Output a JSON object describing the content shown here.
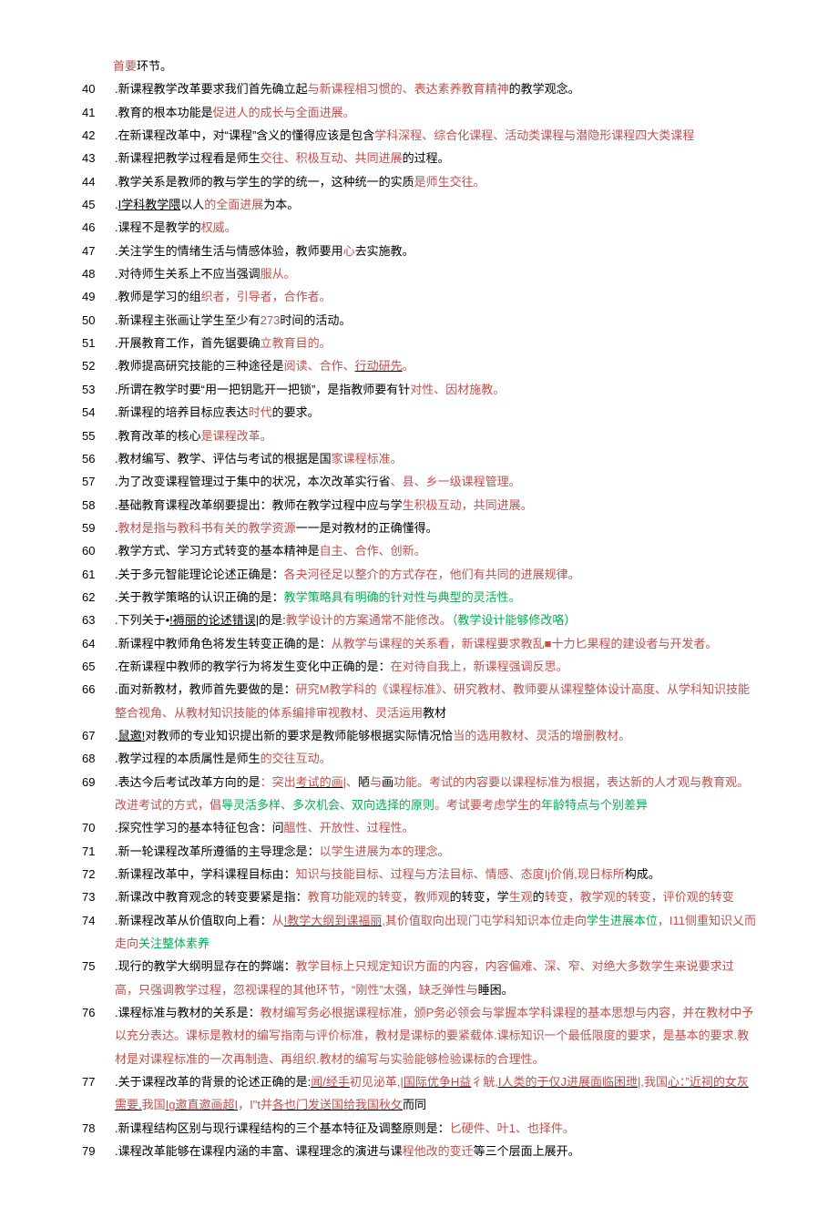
{
  "pre_line": [
    {
      "t": "首要",
      "c": "r"
    },
    {
      "t": "环节。",
      "c": ""
    }
  ],
  "items": [
    {
      "n": "40",
      "segs": [
        {
          "t": ".新课程教学改革要求我们首先确立起",
          "c": ""
        },
        {
          "t": "与新课程相习惯的、表达素养教育精神",
          "c": "r"
        },
        {
          "t": "的教学观念。",
          "c": ""
        }
      ]
    },
    {
      "n": "41",
      "segs": [
        {
          "t": ".教育的根本功能是",
          "c": ""
        },
        {
          "t": "促进人的成长与全面进展。",
          "c": "r"
        }
      ]
    },
    {
      "n": "42",
      "segs": [
        {
          "t": ".在新课程改革中，对“课程”含义的懂得应该是包含",
          "c": ""
        },
        {
          "t": "学科深程、综合化课程、活动类课程与潜隐形课程四大类课程",
          "c": "r"
        }
      ]
    },
    {
      "n": "43",
      "segs": [
        {
          "t": ".新课程把教学过程看是师生",
          "c": ""
        },
        {
          "t": "交往、积极互动、共同进展",
          "c": "r"
        },
        {
          "t": "的过程。",
          "c": ""
        }
      ]
    },
    {
      "n": "44",
      "segs": [
        {
          "t": ".教学关系是教师的教与学生的学的统一，这种统一的实质",
          "c": ""
        },
        {
          "t": "是师生交往。",
          "c": "r"
        }
      ]
    },
    {
      "n": "45",
      "segs": [
        {
          "t": ".",
          "c": ""
        },
        {
          "t": "I学科教学隈",
          "c": "",
          "u": 1
        },
        {
          "t": "以人",
          "c": ""
        },
        {
          "t": "的全面进展",
          "c": "r"
        },
        {
          "t": "为本。",
          "c": ""
        }
      ]
    },
    {
      "n": "46",
      "segs": [
        {
          "t": ".课程不是教学的",
          "c": ""
        },
        {
          "t": "权威。",
          "c": "r"
        }
      ]
    },
    {
      "n": "47",
      "segs": [
        {
          "t": ".关注学生的情绪生活与情感体验，教师要用",
          "c": ""
        },
        {
          "t": "心",
          "c": "r"
        },
        {
          "t": "去实施教。",
          "c": ""
        }
      ]
    },
    {
      "n": "48",
      "segs": [
        {
          "t": ".对待师生关系上不应当强调",
          "c": ""
        },
        {
          "t": "服从。",
          "c": "r"
        }
      ]
    },
    {
      "n": "49",
      "segs": [
        {
          "t": ".教师是学习的组",
          "c": ""
        },
        {
          "t": "织者，引导者，合作者。",
          "c": "r"
        }
      ]
    },
    {
      "n": "50",
      "segs": [
        {
          "t": ".新课程主张画让学生至少有",
          "c": ""
        },
        {
          "t": "273",
          "c": "r"
        },
        {
          "t": "时间的活动。",
          "c": ""
        }
      ]
    },
    {
      "n": "51",
      "segs": [
        {
          "t": ".开展教育工作，首先锯要确",
          "c": ""
        },
        {
          "t": "立教育目的。",
          "c": "r"
        }
      ]
    },
    {
      "n": "52",
      "segs": [
        {
          "t": ".教师提高研究技能的三种途径是",
          "c": ""
        },
        {
          "t": "阅读、合作、",
          "c": "r"
        },
        {
          "t": "行动研先",
          "c": "r",
          "u": 1
        },
        {
          "t": "。",
          "c": "r"
        }
      ]
    },
    {
      "n": "53",
      "segs": [
        {
          "t": ".所谓在教学时要“用一把钥匙开一把锁”，是指教师要有针",
          "c": ""
        },
        {
          "t": "对性、因材施教。",
          "c": "r"
        }
      ]
    },
    {
      "n": "54",
      "segs": [
        {
          "t": ".新课程的培养目标应表达",
          "c": ""
        },
        {
          "t": "时代",
          "c": "r"
        },
        {
          "t": "的要求。",
          "c": ""
        }
      ]
    },
    {
      "n": "55",
      "segs": [
        {
          "t": ".教育改革的核心",
          "c": ""
        },
        {
          "t": "是课程改革。",
          "c": "r"
        }
      ]
    },
    {
      "n": "56",
      "segs": [
        {
          "t": ".教材编写、教学、评估与考试的根据是国",
          "c": ""
        },
        {
          "t": "家课程标准。",
          "c": "r"
        }
      ]
    },
    {
      "n": "57",
      "segs": [
        {
          "t": ".为了改变课程管理过于集中的状况，本次改革实行省",
          "c": ""
        },
        {
          "t": "、县、乡一级课程管理。",
          "c": "r"
        }
      ]
    },
    {
      "n": "58",
      "segs": [
        {
          "t": ".基础教育课程改革纲要提出：教师在教学过程中应与学",
          "c": ""
        },
        {
          "t": "生积极互动，共同进展。",
          "c": "r"
        }
      ]
    },
    {
      "n": "59",
      "segs": [
        {
          "t": ".",
          "c": ""
        },
        {
          "t": "教材是指与教科书有关的教学资源",
          "c": "r"
        },
        {
          "t": "一一是对教材的正确懂得。",
          "c": ""
        }
      ]
    },
    {
      "n": "60",
      "segs": [
        {
          "t": ".教学方式、学习方式转变的基本精神是",
          "c": ""
        },
        {
          "t": "自主、合作、创新。",
          "c": "r"
        }
      ]
    },
    {
      "n": "61",
      "segs": [
        {
          "t": ".关于多元智能理论论述正确是：",
          "c": ""
        },
        {
          "t": "各夬河径足以整介的方式存在，他们有共同的进展规律。",
          "c": "r"
        }
      ]
    },
    {
      "n": "62",
      "segs": [
        {
          "t": ".关于教学策略的认识正确的是：",
          "c": ""
        },
        {
          "t": "教学策略具有明确的针对性与典型的灵活性。",
          "c": "g"
        }
      ]
    },
    {
      "n": "63",
      "segs": [
        {
          "t": ".下列关于•",
          "c": ""
        },
        {
          "t": "!褥丽的论述错误|",
          "c": "",
          "u": 1
        },
        {
          "t": "的是:",
          "c": ""
        },
        {
          "t": "教学设计的方案通常不能修改。",
          "c": "r"
        },
        {
          "t": "（教学设计能够修改咯）",
          "c": "g"
        }
      ]
    },
    {
      "n": "64",
      "segs": [
        {
          "t": ".新课程中教师角色将发生转变正确的是：",
          "c": ""
        },
        {
          "t": "从教学与课程的关系看，新课程要求教乱■十力匕果程的建设者与开发者。",
          "c": "r"
        }
      ]
    },
    {
      "n": "65",
      "segs": [
        {
          "t": ".在新课程中教师的教学行为将发生变化中正确的是：",
          "c": ""
        },
        {
          "t": "在对待自我上，新课程强调反思。",
          "c": "r"
        }
      ]
    },
    {
      "n": "66",
      "segs": [
        {
          "t": ".面对新教材，教师首先要做的是：",
          "c": ""
        },
        {
          "t": "研究M教学科的《课程标准》、研究教材、教师要从课程整体设计高度、从学科知识技能整合视角、从教材知识技能的体系编排审视教材、灵活运用",
          "c": "r"
        },
        {
          "t": "教材",
          "c": ""
        }
      ]
    },
    {
      "n": "67",
      "segs": [
        {
          "t": ".",
          "c": ""
        },
        {
          "t": "鼠邀!",
          "c": "",
          "u": 1
        },
        {
          "t": "对教师的专业知识提出新的要求是教师能够根据实际情况恰",
          "c": ""
        },
        {
          "t": "当的选用教材、灵活的增删教材。",
          "c": "r"
        }
      ]
    },
    {
      "n": "68",
      "segs": [
        {
          "t": ".教学过程的本质属性是师生",
          "c": ""
        },
        {
          "t": "的交往互动。",
          "c": "r"
        }
      ]
    },
    {
      "n": "69",
      "segs": [
        {
          "t": ".表达今后考试改革方向的是",
          "c": ""
        },
        {
          "t": "：突出",
          "c": "r"
        },
        {
          "t": "考试的画|",
          "c": "r",
          "u": 1
        },
        {
          "t": "、",
          "c": "r"
        },
        {
          "t": "陋",
          "c": ""
        },
        {
          "t": "与",
          "c": "r"
        },
        {
          "t": "画",
          "c": ""
        },
        {
          "t": "功能。考试的内容要以课程标准为根据，表达新的人才观与教育观",
          "c": "r"
        },
        {
          "t": "。改进考试的方式，倡",
          "c": "r"
        },
        {
          "t": "导灵活多样、多次机会、双向选择的原则",
          "c": "g"
        },
        {
          "t": "。考试要考虑学生的",
          "c": "r"
        },
        {
          "t": "年龄特点与个别差异",
          "c": "g"
        }
      ]
    },
    {
      "n": "70",
      "segs": [
        {
          "t": ".探究性学习的基本特征包含：问",
          "c": ""
        },
        {
          "t": "醞性、开放性、过程性。",
          "c": "r"
        }
      ]
    },
    {
      "n": "71",
      "segs": [
        {
          "t": ".新一轮课程改革所遵循的主导理念是：",
          "c": ""
        },
        {
          "t": "以学生进展为本的理念。",
          "c": "r"
        }
      ]
    },
    {
      "n": "72",
      "segs": [
        {
          "t": ".新课程改革中，学科课程目标由：",
          "c": ""
        },
        {
          "t": "知识与技能目标、过程与方法目标、情感、态度Ij价俏,现日标所",
          "c": "r"
        },
        {
          "t": "构成。",
          "c": ""
        }
      ]
    },
    {
      "n": "73",
      "segs": [
        {
          "t": ".新课改中教育观念的转变要紧是指：",
          "c": ""
        },
        {
          "t": "教育功能观的转变，教师观",
          "c": "r"
        },
        {
          "t": "的转变，学",
          "c": ""
        },
        {
          "t": "生观",
          "c": "r"
        },
        {
          "t": "的",
          "c": ""
        },
        {
          "t": "转变，教学观的转变，评价观的转变",
          "c": "r"
        }
      ]
    },
    {
      "n": "74",
      "segs": [
        {
          "t": ".新课程改革从价值取向上看：",
          "c": ""
        },
        {
          "t": "从",
          "c": "r"
        },
        {
          "t": "!教学大纲到课褔丽,",
          "c": "r",
          "u": 1
        },
        {
          "t": "其价值取向出现门屯学科知识本位走向",
          "c": "r"
        },
        {
          "t": "学生进展本位",
          "c": "g"
        },
        {
          "t": "，I11侧重知识乂而走向",
          "c": "r"
        },
        {
          "t": "关注整体素养",
          "c": "g"
        }
      ]
    },
    {
      "n": "75",
      "segs": [
        {
          "t": ".现行的教学大纲明显存在的弊端：",
          "c": ""
        },
        {
          "t": "教学目标上只规定知识方面的内容，内容偏难、深、窄、对绝大多数学生来说要求过高，只强调教学过程，忽视课程的其他环节，“刚性”太强，缺乏弹性与",
          "c": "r"
        },
        {
          "t": "睡困。",
          "c": ""
        }
      ]
    },
    {
      "n": "76",
      "segs": [
        {
          "t": ".课程标准与教材的关系是：",
          "c": ""
        },
        {
          "t": "教材编写务必根据课程标准，颁P务必领会与掌握本学科课程的基本思想与内容，并在教材中予以充分表达。课标是教材的编写指南与评价标准，教材是课标的要紧载体.课标知识一个最低限度的要求，是基本的要求.教材是对课程标准的一次再制造、再组织.教材的编写与实验能够检验课标的合理性。",
          "c": "r"
        }
      ]
    },
    {
      "n": "77",
      "segs": [
        {
          "t": ".关于课程改革的背景的论述正确的是:",
          "c": ""
        },
        {
          "t": "闻/经手",
          "c": "r",
          "u": 1
        },
        {
          "t": "初见泌革,",
          "c": "r"
        },
        {
          "t": "|国际优争H益",
          "c": "r",
          "u": 1
        },
        {
          "t": "彳觥,",
          "c": "r"
        },
        {
          "t": "I人类的于仅J进展面临困玴|",
          "c": "r",
          "u": 1
        },
        {
          "t": ",我国",
          "c": "r"
        },
        {
          "t": "心：”近祠的女灰需要,",
          "c": "r",
          "u": 1
        },
        {
          "t": "我国",
          "c": "r"
        },
        {
          "t": "Ig邀直邀画超I",
          "c": "r",
          "u": 1
        },
        {
          "t": "，I\"t并",
          "c": "r"
        },
        {
          "t": "各也门发送国给我国秋攵",
          "c": "r",
          "u": 1
        },
        {
          "t": "而同",
          "c": ""
        }
      ]
    },
    {
      "n": "78",
      "segs": [
        {
          "t": ".新课程结构区别与现行课程结构的三个基本特征及调整原则是：",
          "c": ""
        },
        {
          "t": "匕硬件、叶1、也择件。",
          "c": "r"
        }
      ]
    },
    {
      "n": "79",
      "segs": [
        {
          "t": ".课程改革能够在课程内涵的丰富、课程理念的演进与课",
          "c": ""
        },
        {
          "t": "程他改的变迁",
          "c": "r"
        },
        {
          "t": "等三个层面上展开。",
          "c": ""
        }
      ]
    }
  ]
}
